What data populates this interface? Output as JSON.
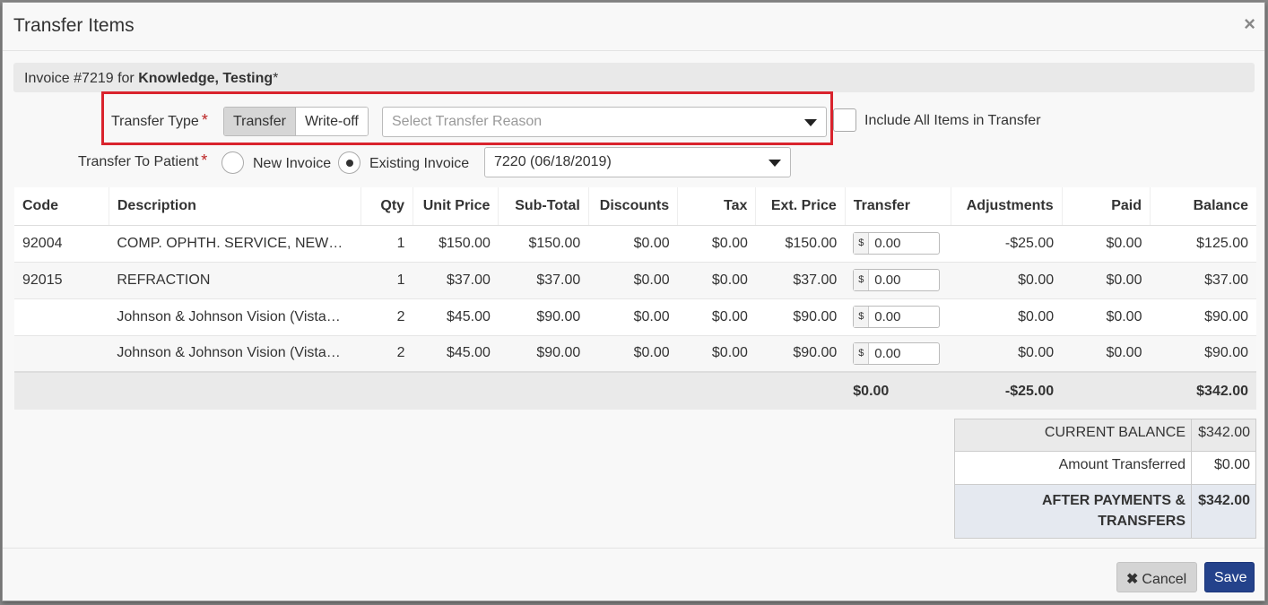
{
  "modal": {
    "title": "Transfer Items",
    "close_glyph": "×"
  },
  "invoice": {
    "prefix": "Invoice #7219 for ",
    "patient": "Knowledge, Testing",
    "suffix": "*"
  },
  "form": {
    "transfer_type_label": "Transfer Type",
    "required_mark": "*",
    "transfer_type_options": [
      "Transfer",
      "Write-off"
    ],
    "transfer_type_selected": "Transfer",
    "reason_placeholder": "Select Transfer Reason",
    "include_all_label": "Include All Items in Transfer",
    "transfer_to_label": "Transfer To Patient",
    "new_invoice_label": "New Invoice",
    "existing_invoice_label": "Existing Invoice",
    "existing_invoice_selected": true,
    "existing_invoice_value": "7220 (06/18/2019)"
  },
  "table": {
    "headers": [
      "Code",
      "Description",
      "Qty",
      "Unit Price",
      "Sub-Total",
      "Discounts",
      "Tax",
      "Ext. Price",
      "Transfer",
      "Adjustments",
      "Paid",
      "Balance"
    ],
    "currency_addon": "$",
    "rows": [
      {
        "code": "92004",
        "description": "COMP. OPHTH. SERVICE, NEW…",
        "qty": "1",
        "unit_price": "$150.00",
        "subtotal": "$150.00",
        "discounts": "$0.00",
        "tax": "$0.00",
        "ext_price": "$150.00",
        "transfer": "0.00",
        "adjustments": "-$25.00",
        "paid": "$0.00",
        "balance": "$125.00"
      },
      {
        "code": "92015",
        "description": "REFRACTION",
        "qty": "1",
        "unit_price": "$37.00",
        "subtotal": "$37.00",
        "discounts": "$0.00",
        "tax": "$0.00",
        "ext_price": "$37.00",
        "transfer": "0.00",
        "adjustments": "$0.00",
        "paid": "$0.00",
        "balance": "$37.00"
      },
      {
        "code": "",
        "description": "Johnson & Johnson Vision (Vista…",
        "qty": "2",
        "unit_price": "$45.00",
        "subtotal": "$90.00",
        "discounts": "$0.00",
        "tax": "$0.00",
        "ext_price": "$90.00",
        "transfer": "0.00",
        "adjustments": "$0.00",
        "paid": "$0.00",
        "balance": "$90.00"
      },
      {
        "code": "",
        "description": "Johnson & Johnson Vision (Vista…",
        "qty": "2",
        "unit_price": "$45.00",
        "subtotal": "$90.00",
        "discounts": "$0.00",
        "tax": "$0.00",
        "ext_price": "$90.00",
        "transfer": "0.00",
        "adjustments": "$0.00",
        "paid": "$0.00",
        "balance": "$90.00"
      }
    ],
    "totals": {
      "transfer": "$0.00",
      "adjustments": "-$25.00",
      "balance": "$342.00"
    }
  },
  "summary": {
    "current_balance_label": "CURRENT BALANCE",
    "current_balance_value": "$342.00",
    "amount_transferred_label": "Amount Transferred",
    "amount_transferred_value": "$0.00",
    "after_label": "AFTER PAYMENTS & TRANSFERS",
    "after_value": "$342.00"
  },
  "footer": {
    "cancel_label": "Cancel",
    "cancel_glyph": "✖",
    "save_label": "Save"
  },
  "colors": {
    "highlight": "#d9232d",
    "save_button": "#24428b",
    "required": "#b22222"
  }
}
